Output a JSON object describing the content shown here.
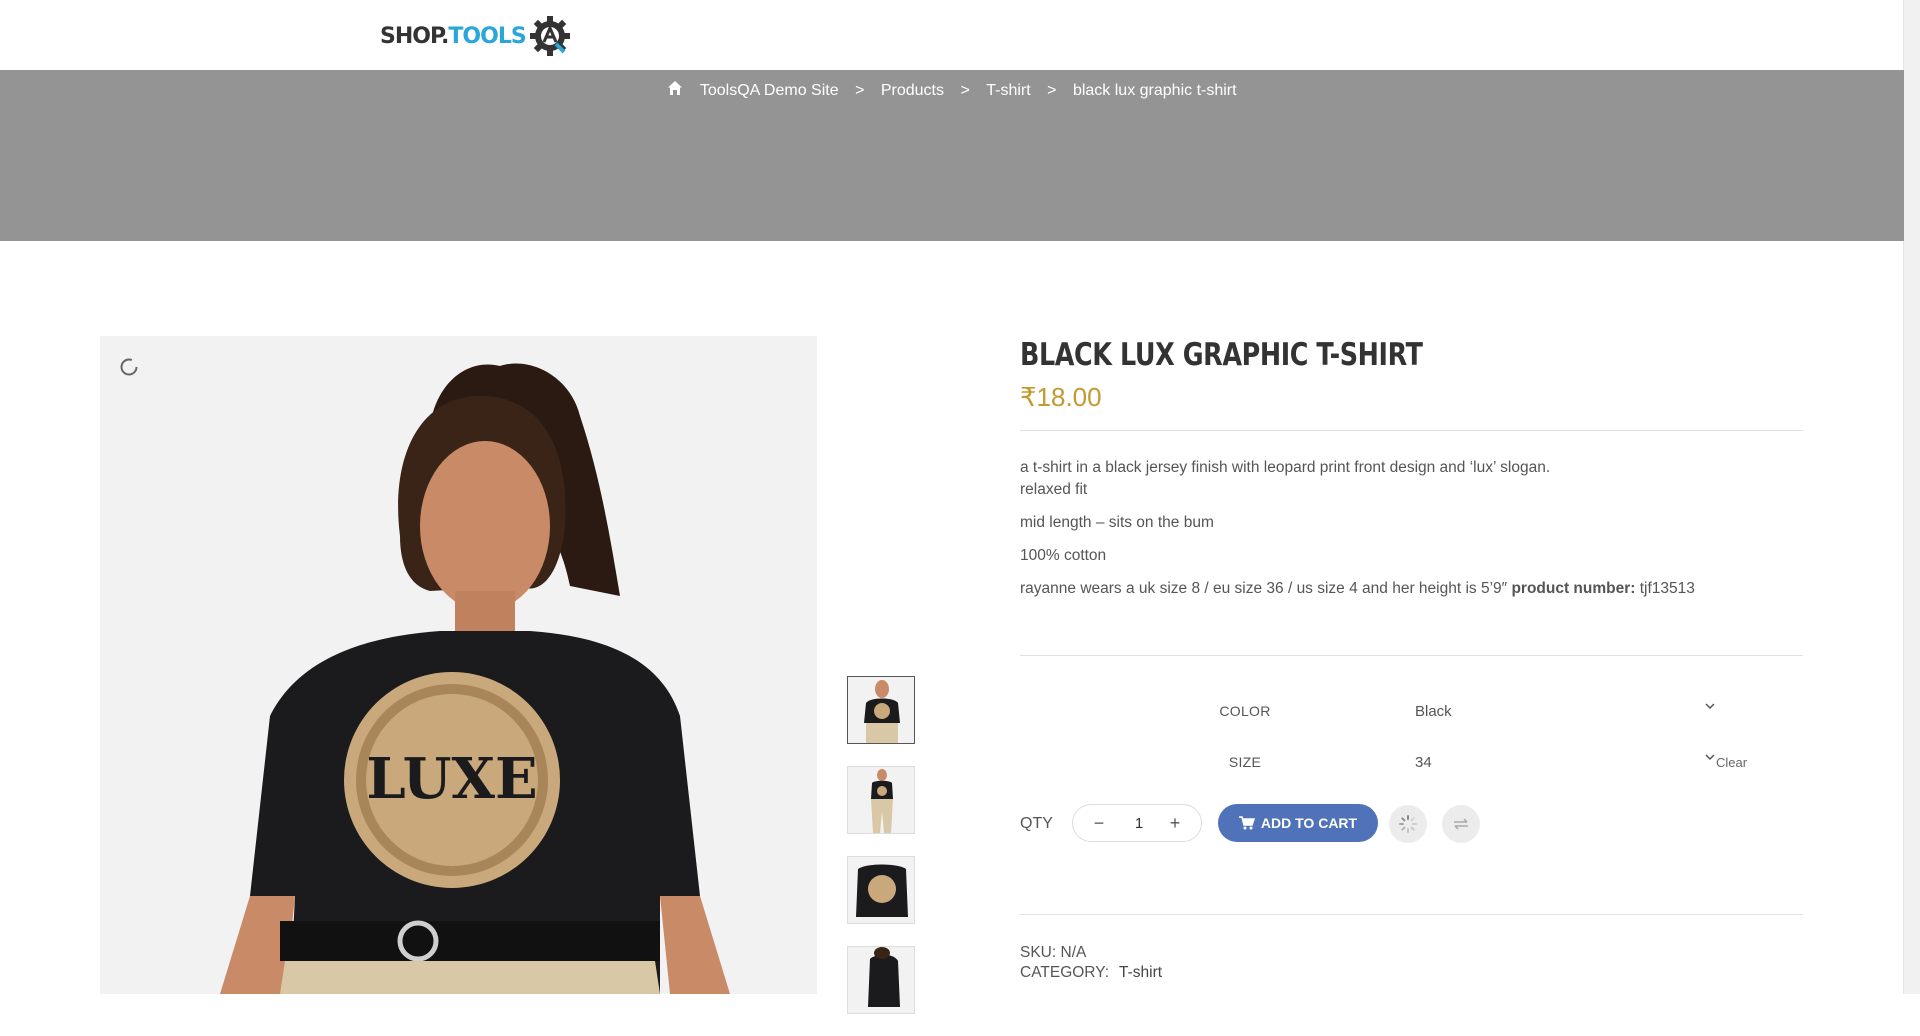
{
  "header": {
    "logo_part1": "SHOP.",
    "logo_part2": "TOOLS"
  },
  "breadcrumb": {
    "items": [
      "ToolsQA Demo Site",
      "Products",
      "T-shirt",
      "black lux graphic t-shirt"
    ],
    "separator": ">"
  },
  "product": {
    "title": "BLACK LUX GRAPHIC T-SHIRT",
    "price": "₹18.00",
    "description": [
      "a t-shirt in a black jersey finish with leopard print front design and ‘lux’ slogan.",
      "relaxed fit",
      "mid length – sits on the bum",
      "100% cotton"
    ],
    "model_info": "rayanne wears a uk size 8 / eu size 36 / us size 4 and her height is 5’9″",
    "product_number_label": "product number:",
    "product_number": " tjf13513",
    "images": [
      "main-tshirt-image",
      "thumb-1",
      "thumb-2",
      "thumb-3",
      "thumb-4"
    ]
  },
  "variations": {
    "color_label": "COLOR",
    "color_value": "Black",
    "size_label": "SIZE",
    "size_value": "34",
    "clear_label": "Clear"
  },
  "cart": {
    "qty_label": "QTY",
    "qty_minus": "−",
    "qty_plus": "+",
    "qty_value": "1",
    "add_to_cart": "ADD TO CART"
  },
  "meta": {
    "sku_label": "SKU:",
    "sku_value": "N/A",
    "category_label": "CATEGORY:",
    "category_value": "T-shirt"
  },
  "colors": {
    "accent_price": "#c39a2f",
    "cart_button": "#5072b8",
    "banner": "#949494",
    "logo_blue": "#2aa7d8"
  },
  "icons": {
    "home": "home-icon",
    "zoom": "zoom-icon",
    "cart": "cart-icon",
    "wishlist": "loading-spinner-icon",
    "compare": "compare-icon"
  }
}
